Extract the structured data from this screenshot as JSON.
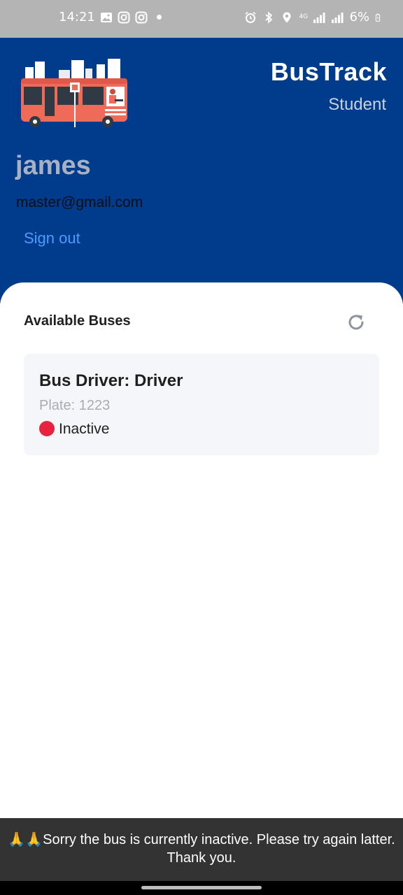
{
  "status_bar": {
    "time": "14:21",
    "battery": "6%",
    "network": "4G"
  },
  "header": {
    "app_title": "BusTrack",
    "role": "Student",
    "user_name": "james",
    "user_email": "master@gmail.com",
    "signout_label": "Sign out",
    "colors": {
      "background": "#003b8c",
      "bus_body": "#f06a5a",
      "link": "#4c9bff"
    }
  },
  "buses_section": {
    "title": "Available Buses",
    "refresh_icon": "refresh-icon",
    "items": [
      {
        "driver": "Bus Driver: Driver",
        "plate": "Plate: 1223",
        "status": "Inactive",
        "status_color": "#e8233f"
      }
    ]
  },
  "toast": {
    "message": "🙏🙏Sorry the bus is currently inactive. Please try again latter. Thank you."
  }
}
